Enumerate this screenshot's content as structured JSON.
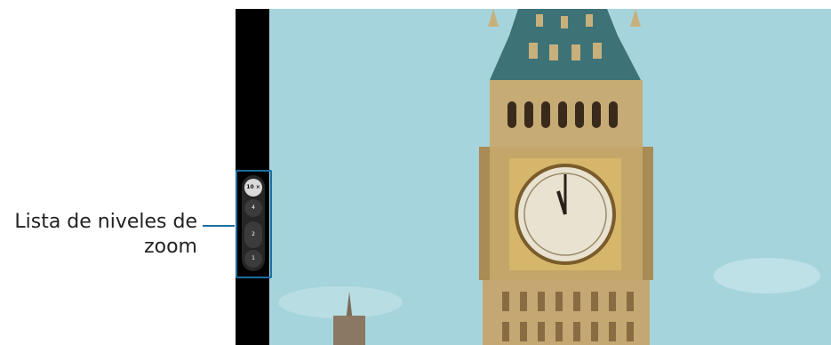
{
  "callout": {
    "line1": "Lista de niveles de",
    "line2": "zoom"
  },
  "zoom_levels": [
    {
      "label": "10 ×",
      "selected": true
    },
    {
      "label": "4",
      "selected": false
    },
    {
      "label": "2",
      "selected": false
    },
    {
      "label": "1",
      "selected": false
    }
  ],
  "colors": {
    "accent": "#1b6fa3",
    "sky": "#9fd1d9",
    "stone": "#c9ad78",
    "roof": "#3a6f74"
  }
}
